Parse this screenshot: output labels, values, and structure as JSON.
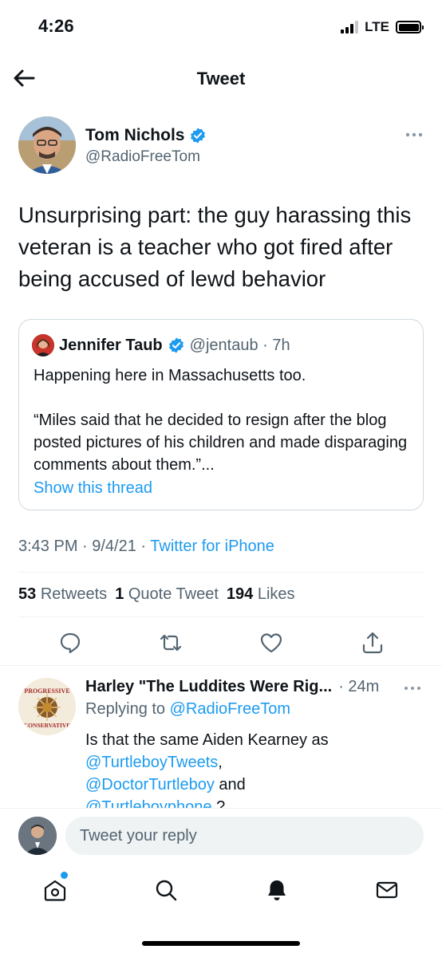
{
  "status_bar": {
    "time": "4:26",
    "network": "LTE"
  },
  "nav": {
    "title": "Tweet"
  },
  "tweet": {
    "author_name": "Tom Nichols",
    "author_handle": "@RadioFreeTom",
    "text": "Unsurprising part: the guy harassing this veteran is a teacher who got fired after being accused of lewd behavior",
    "timestamp": "3:43 PM · 9/4/21 · ",
    "client": "Twitter for iPhone",
    "stats": {
      "retweets_count": "53",
      "retweets_label": "Retweets",
      "quotes_count": "1",
      "quotes_label": "Quote Tweet",
      "likes_count": "194",
      "likes_label": "Likes"
    }
  },
  "quote": {
    "author_name": "Jennifer Taub",
    "author_handle": "@jentaub",
    "time": " · 7h",
    "line1": "Happening here in Massachusetts too.",
    "line2": "“Miles said that he decided to resign after the blog posted pictures of his children and made disparaging comments about them.”...",
    "show_thread": "Show this thread"
  },
  "reply": {
    "author_name": "Harley \"The Luddites Were Rig...",
    "time": "· 24m",
    "replying_label": "Replying to ",
    "replying_handle": "@RadioFreeTom",
    "text_1": "Is that the same Aiden Kearney as",
    "link_1": "@TurtleboyTweets",
    "text_2": ",",
    "link_2": "@DoctorTurtleboy",
    "text_3": " and",
    "link_3": "@Turtleboyphone",
    "text_4": " ?",
    "avatar_text_top": "PROGRESSIVE",
    "avatar_text_bottom": "CONSERVATIVE"
  },
  "compose": {
    "placeholder": "Tweet your reply"
  },
  "colors": {
    "accent": "#1d9bf0",
    "secondary_text": "#536471",
    "divider": "#eff3f4"
  },
  "icons": [
    "back-arrow-icon",
    "verified-badge-icon",
    "more-dots-icon",
    "reply-icon",
    "retweet-icon",
    "like-icon",
    "share-icon",
    "home-icon",
    "search-icon",
    "notifications-icon",
    "messages-icon"
  ]
}
